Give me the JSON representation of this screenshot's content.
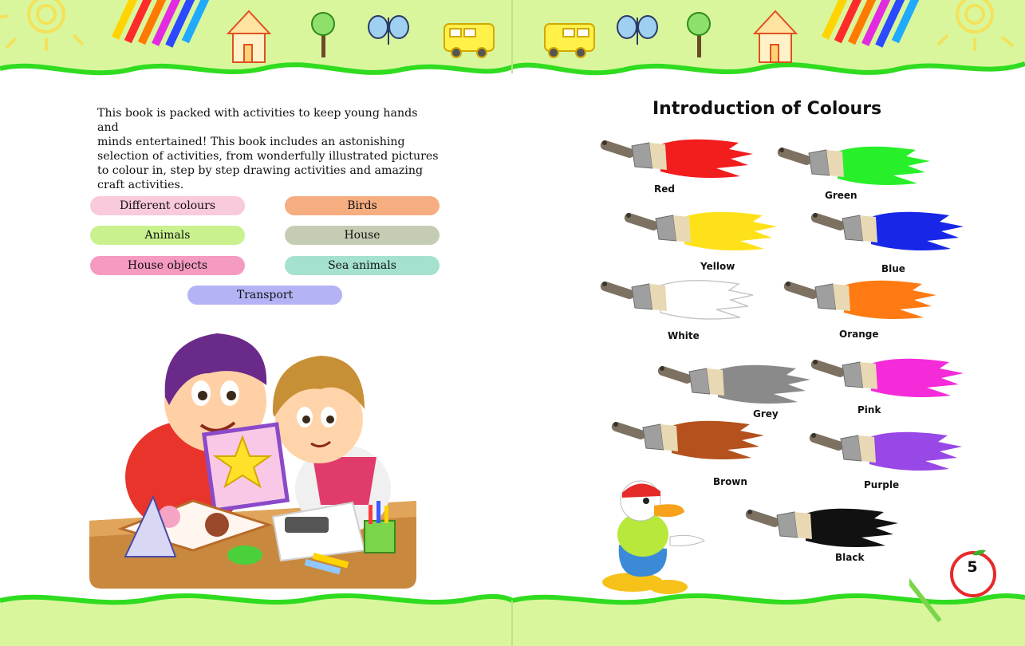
{
  "intro": {
    "line1": "This book is packed with activities to keep young hands and",
    "line2": "minds entertained! This book includes an astonishing",
    "line3": "selection of activities, from wonderfully illustrated pictures",
    "line4": "to colour in, step by step drawing activities and amazing",
    "line5": "craft activities."
  },
  "topics": [
    {
      "label": "Different colours",
      "color": "#f9c9dc"
    },
    {
      "label": "Birds",
      "color": "#f6ad80"
    },
    {
      "label": "Animals",
      "color": "#c9f28e"
    },
    {
      "label": "House",
      "color": "#c4cdb3"
    },
    {
      "label": "House objects",
      "color": "#f59ac0"
    },
    {
      "label": "Sea animals",
      "color": "#a4e1cf"
    },
    {
      "label": "Transport",
      "color": "#b3b3f5"
    }
  ],
  "title": "Introduction of Colours",
  "colours": [
    {
      "name": "Red",
      "hex": "#f21d1d"
    },
    {
      "name": "Green",
      "hex": "#27ef2a"
    },
    {
      "name": "Yellow",
      "hex": "#ffe11a"
    },
    {
      "name": "Blue",
      "hex": "#1826e8"
    },
    {
      "name": "White",
      "hex": "#ffffff"
    },
    {
      "name": "Orange",
      "hex": "#ff7a12"
    },
    {
      "name": "Grey",
      "hex": "#8a8a8a"
    },
    {
      "name": "Pink",
      "hex": "#f52bd9"
    },
    {
      "name": "Brown",
      "hex": "#b4511d"
    },
    {
      "name": "Purple",
      "hex": "#9848e6"
    },
    {
      "name": "Black",
      "hex": "#111111"
    }
  ],
  "page_number": "5",
  "theme": {
    "band": "#d9f69d",
    "wave": "#2fdc1f"
  }
}
